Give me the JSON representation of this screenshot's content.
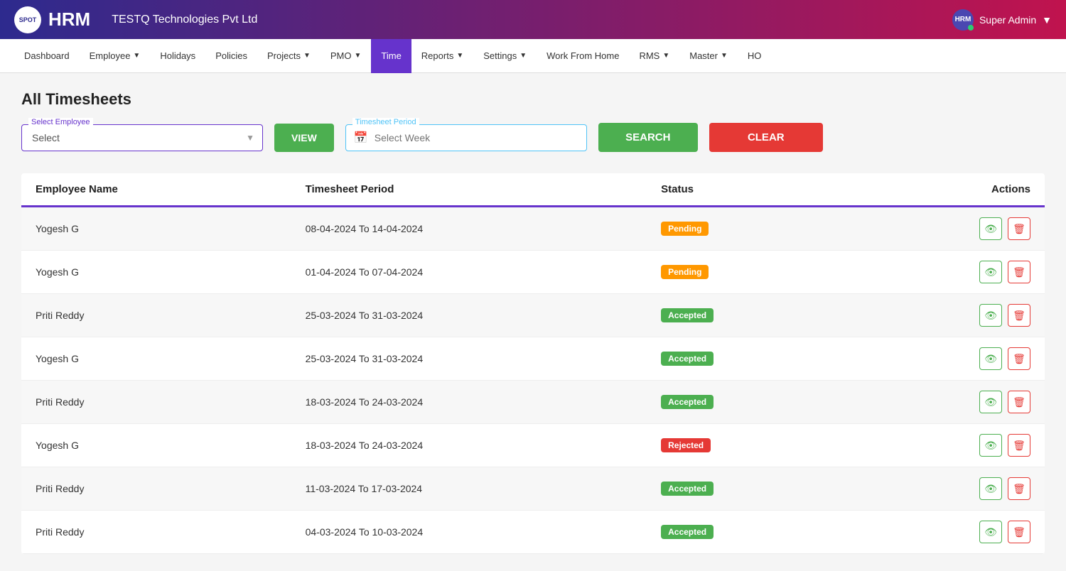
{
  "app": {
    "logo_text": "HRM",
    "logo_spot": "SPOT",
    "company": "TESTQ Technologies Pvt Ltd",
    "user": "Super Admin",
    "avatar": "HRM"
  },
  "nav": {
    "items": [
      {
        "label": "Dashboard",
        "has_dropdown": false,
        "active": false
      },
      {
        "label": "Employee",
        "has_dropdown": true,
        "active": false
      },
      {
        "label": "Holidays",
        "has_dropdown": false,
        "active": false
      },
      {
        "label": "Policies",
        "has_dropdown": false,
        "active": false
      },
      {
        "label": "Projects",
        "has_dropdown": true,
        "active": false
      },
      {
        "label": "PMO",
        "has_dropdown": true,
        "active": false
      },
      {
        "label": "Time",
        "has_dropdown": false,
        "active": true
      },
      {
        "label": "Reports",
        "has_dropdown": true,
        "active": false
      },
      {
        "label": "Settings",
        "has_dropdown": true,
        "active": false
      },
      {
        "label": "Work From Home",
        "has_dropdown": false,
        "active": false
      },
      {
        "label": "RMS",
        "has_dropdown": true,
        "active": false
      },
      {
        "label": "Master",
        "has_dropdown": true,
        "active": false
      },
      {
        "label": "HO",
        "has_dropdown": false,
        "active": false
      }
    ]
  },
  "page": {
    "title": "All Timesheets"
  },
  "filters": {
    "employee_label": "Select Employee",
    "employee_placeholder": "Select",
    "period_label": "Timesheet Period",
    "period_placeholder": "Select Week",
    "view_btn": "VIEW",
    "search_btn": "SEARCH",
    "clear_btn": "CLEAR"
  },
  "table": {
    "headers": [
      "Employee Name",
      "Timesheet Period",
      "Status",
      "Actions"
    ],
    "rows": [
      {
        "employee": "Yogesh G",
        "period": "08-04-2024 To 14-04-2024",
        "status": "Pending",
        "status_class": "badge-pending"
      },
      {
        "employee": "Yogesh G",
        "period": "01-04-2024 To 07-04-2024",
        "status": "Pending",
        "status_class": "badge-pending"
      },
      {
        "employee": "Priti Reddy",
        "period": "25-03-2024 To 31-03-2024",
        "status": "Accepted",
        "status_class": "badge-accepted"
      },
      {
        "employee": "Yogesh G",
        "period": "25-03-2024 To 31-03-2024",
        "status": "Accepted",
        "status_class": "badge-accepted"
      },
      {
        "employee": "Priti Reddy",
        "period": "18-03-2024 To 24-03-2024",
        "status": "Accepted",
        "status_class": "badge-accepted"
      },
      {
        "employee": "Yogesh G",
        "period": "18-03-2024 To 24-03-2024",
        "status": "Rejected",
        "status_class": "badge-rejected"
      },
      {
        "employee": "Priti Reddy",
        "period": "11-03-2024 To 17-03-2024",
        "status": "Accepted",
        "status_class": "badge-accepted"
      },
      {
        "employee": "Priti Reddy",
        "period": "04-03-2024 To 10-03-2024",
        "status": "Accepted",
        "status_class": "badge-accepted"
      }
    ]
  }
}
